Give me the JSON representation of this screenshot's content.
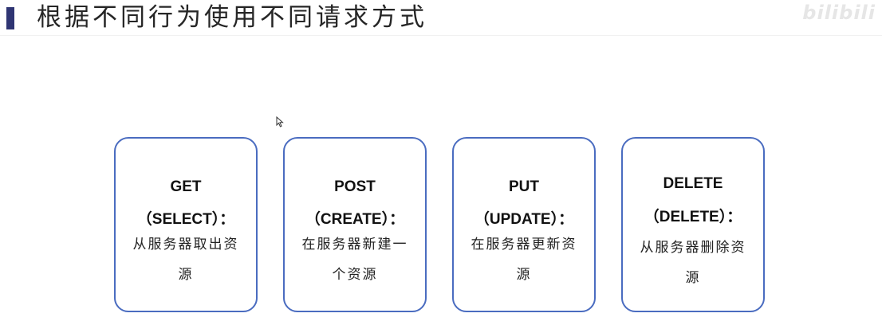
{
  "slide": {
    "title": "根据不同行为使用不同请求方式",
    "watermark": "bilibili",
    "accent_color": "#2f3573",
    "card_border_color": "#4a6cc0"
  },
  "cards": [
    {
      "method": "GET",
      "op": "（SELECT）：",
      "desc": "从服务器取出资源"
    },
    {
      "method": "POST",
      "op": "（CREATE）：",
      "desc": "在服务器新建一个资源"
    },
    {
      "method": "PUT",
      "op": "（UPDATE）：",
      "desc": "在服务器更新资源"
    },
    {
      "method": "DELETE",
      "op": "（DELETE）：",
      "desc": "从服务器删除资源"
    }
  ],
  "icons": {
    "cursor": "mouse-pointer-icon"
  }
}
